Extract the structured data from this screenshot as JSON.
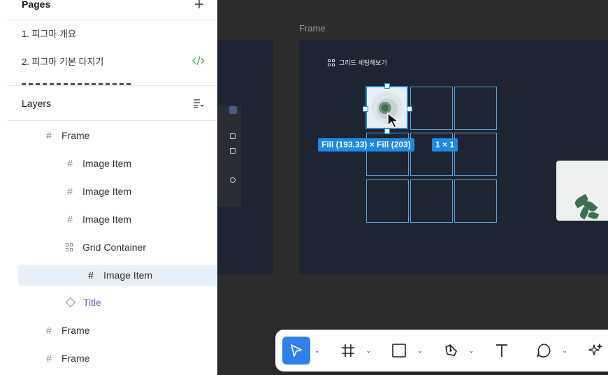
{
  "pages": {
    "title": "Pages",
    "items": [
      {
        "label": "1. 피그마 개요"
      },
      {
        "label": "2. 피그마 기본 다지기"
      }
    ]
  },
  "layers": {
    "title": "Layers",
    "items": [
      {
        "label": "Frame",
        "icon": "hash-icon",
        "level": 0
      },
      {
        "label": "Image Item",
        "icon": "hash-icon",
        "level": 1
      },
      {
        "label": "Image Item",
        "icon": "hash-icon",
        "level": 1
      },
      {
        "label": "Image Item",
        "icon": "hash-icon",
        "level": 1
      },
      {
        "label": "Grid Container",
        "icon": "grid-icon",
        "level": 1
      },
      {
        "label": "Image Item",
        "icon": "hash-icon",
        "level": 2,
        "selected": true
      },
      {
        "label": "Title",
        "icon": "diamond-icon",
        "level": 1
      },
      {
        "label": "Frame",
        "icon": "hash-icon",
        "level": 0
      },
      {
        "label": "Frame",
        "icon": "hash-icon",
        "level": 0
      }
    ]
  },
  "canvas": {
    "frame_label": "Frame",
    "grid_title": "그리드 세팅해보기",
    "size_badge": "Fill (193.33) × Fill (203)",
    "grid_badge": "1 × 1"
  },
  "toolbar": {
    "tools": [
      "move-tool",
      "frame-tool",
      "rectangle-tool",
      "pen-tool",
      "text-tool",
      "comment-tool",
      "actions-tool"
    ]
  },
  "colors": {
    "accent": "#1e88e5",
    "canvas_bg": "#2c2c2c",
    "frame_bg": "#1e2431",
    "selection_bg": "#e5f0fb",
    "title_layer": "#7b5cbf"
  }
}
